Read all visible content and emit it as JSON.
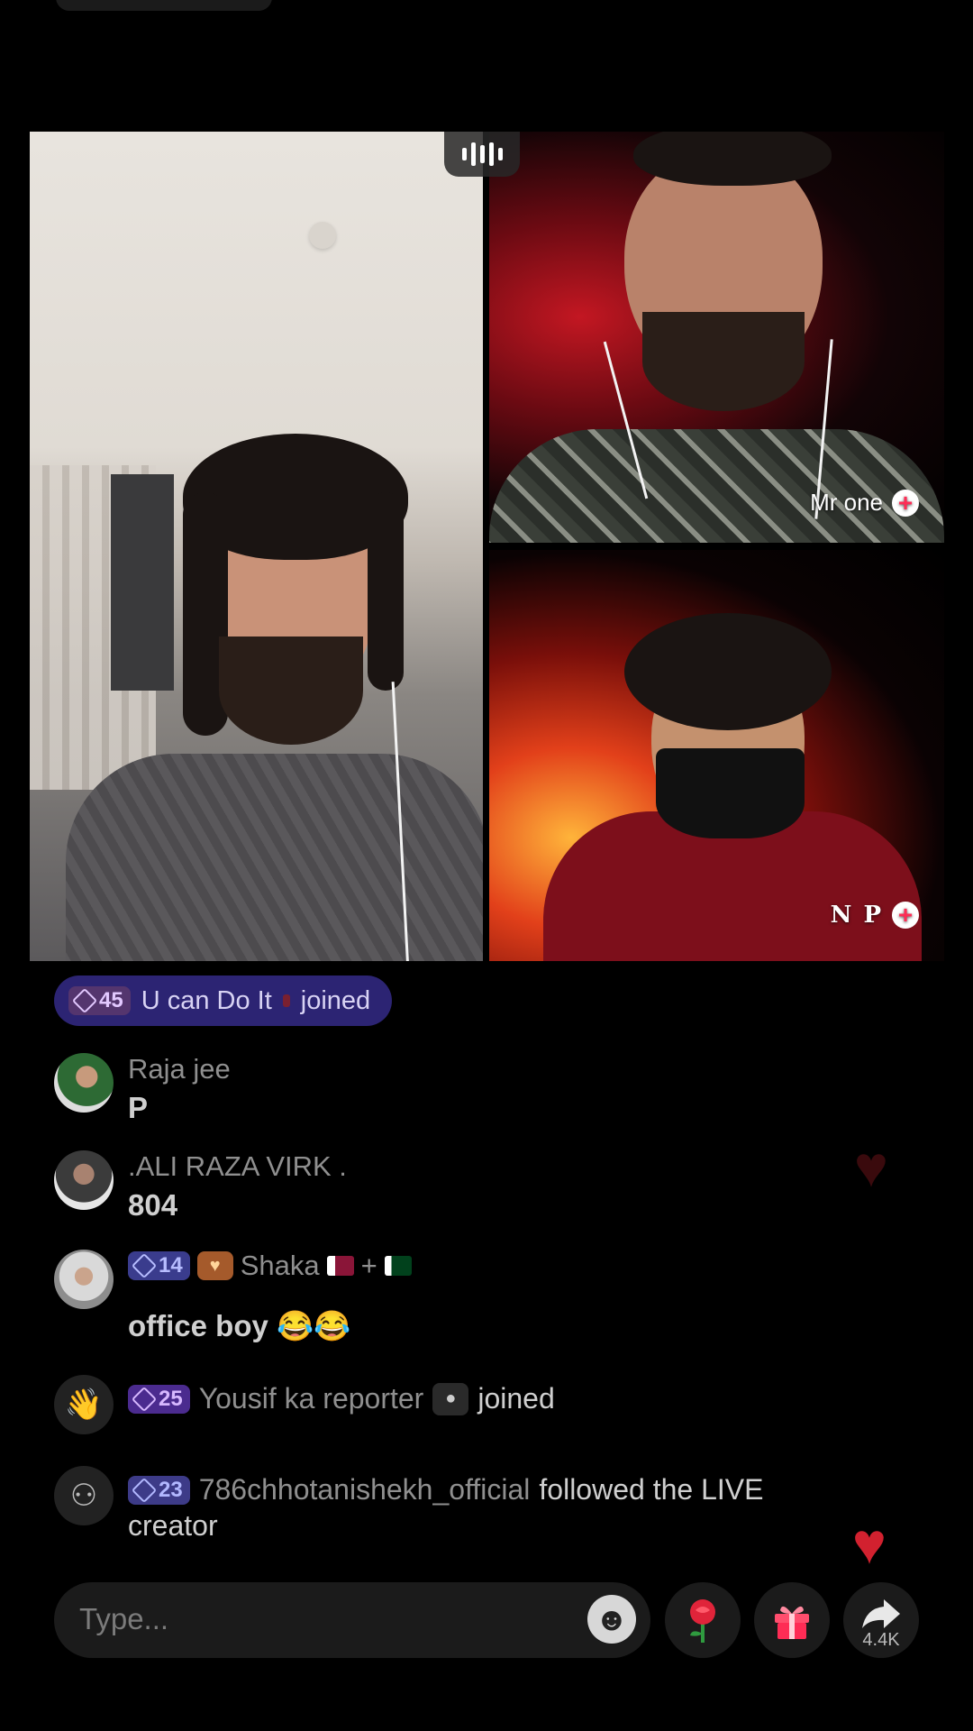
{
  "stream": {
    "host_tile": {},
    "guests": [
      {
        "name": "Mr one"
      },
      {
        "name": "N P"
      }
    ]
  },
  "join_banner": {
    "level": "45",
    "user": "U can Do It",
    "action": "joined",
    "color": "#2c2473"
  },
  "comments": [
    {
      "user": "Raja jee",
      "text": "P"
    },
    {
      "user": ".ALI RAZA VIRK .",
      "text": "804"
    },
    {
      "user": "Shaka",
      "level": "14",
      "flags_sep": "+",
      "text": "office boy 😂😂"
    }
  ],
  "system_events": [
    {
      "icon": "wave-icon",
      "level": "25",
      "user": "Yousif ka reporter",
      "action": "joined"
    },
    {
      "icon": "follow-icon",
      "level": "23",
      "user": "786chhotanishekh_official",
      "action": "followed the LIVE",
      "action_cont": "creator"
    }
  ],
  "bottom_bar": {
    "placeholder": "Type...",
    "share_count": "4.4K",
    "accent": "#fe2c55"
  }
}
